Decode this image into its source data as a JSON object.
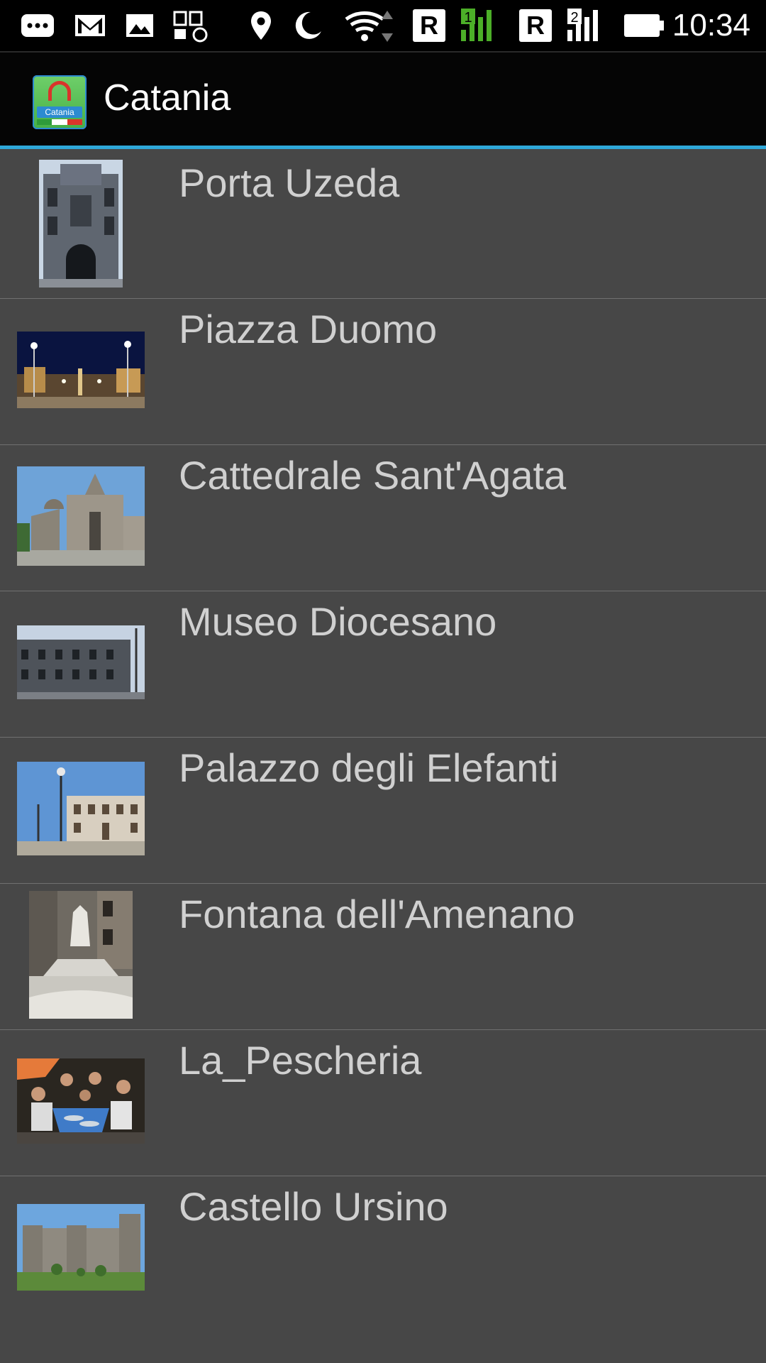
{
  "status_bar": {
    "time": "10:34",
    "sim1_label": "R",
    "sim2_label": "R",
    "signal1_badge": "1",
    "signal2_badge": "2",
    "icons": [
      "chat-icon",
      "gmail-icon",
      "gallery-icon",
      "data-usage-icon",
      "location-icon",
      "moon-icon",
      "wifi-icon",
      "signal-icon",
      "battery-icon"
    ]
  },
  "action_bar": {
    "title": "Catania",
    "icon_text": "Catania"
  },
  "places": [
    {
      "name": "Porta Uzeda",
      "thumb": "portrait"
    },
    {
      "name": "Piazza Duomo",
      "thumb": "night"
    },
    {
      "name": "Cattedrale Sant'Agata",
      "thumb": "day"
    },
    {
      "name": "Museo Diocesano",
      "thumb": "grey"
    },
    {
      "name": "Palazzo degli Elefanti",
      "thumb": "sky"
    },
    {
      "name": "Fontana dell'Amenano",
      "thumb": "fountain"
    },
    {
      "name": "La_Pescheria",
      "thumb": "market"
    },
    {
      "name": "Castello Ursino",
      "thumb": "castle"
    }
  ],
  "colors": {
    "accent": "#2fa8d9",
    "list_background": "#474747",
    "item_text": "#d0d0d0",
    "divider": "#707070"
  }
}
